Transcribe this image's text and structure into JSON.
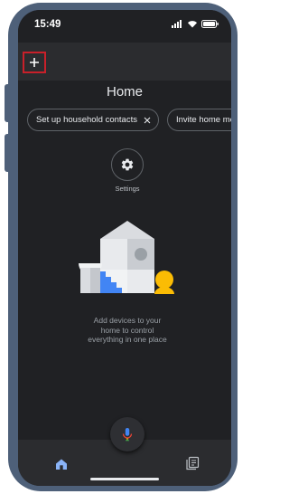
{
  "status_bar": {
    "time": "15:49",
    "icons": [
      "signal-icon",
      "wifi-icon",
      "battery-icon"
    ]
  },
  "app_bar": {
    "add_icon": "plus-icon",
    "highlight_color": "#c8202a"
  },
  "page": {
    "title": "Home"
  },
  "chips": [
    {
      "label": "Set up household contacts",
      "icon": "close-icon"
    },
    {
      "label": "Invite home mem"
    }
  ],
  "settings": {
    "label": "Settings",
    "icon": "gear-icon"
  },
  "empty_state": {
    "lines": [
      "Add devices to your",
      "home to control",
      "everything in one place"
    ]
  },
  "bottom_nav": {
    "items": [
      "home-icon",
      "feed-icon"
    ]
  },
  "assistant": {
    "icon": "mic-icon"
  },
  "colors": {
    "background": "#202124",
    "bar": "#2b2c2f",
    "frame": "#4e6079",
    "text": "#e8eaed",
    "google_blue": "#4285f4",
    "google_red": "#ea4335",
    "google_yellow": "#fbbc04",
    "google_green": "#34a853"
  }
}
